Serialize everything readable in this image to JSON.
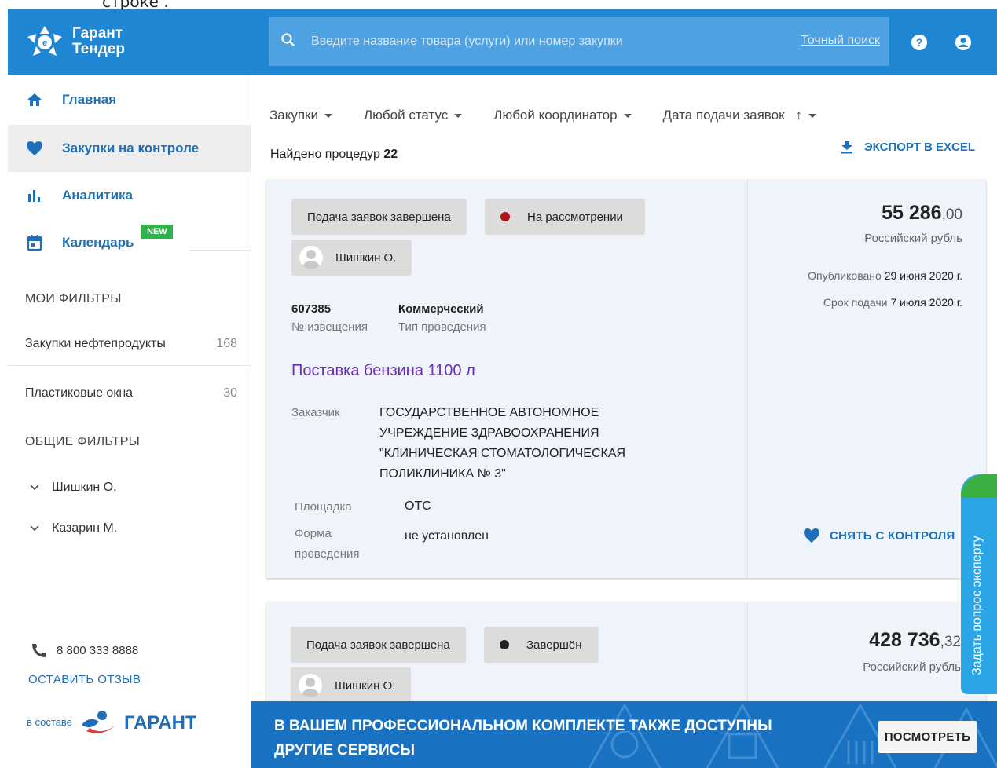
{
  "top_snippet": "строке                    .",
  "header": {
    "logo_line1": "Гарант",
    "logo_line2": "Тендер",
    "search_placeholder": "Введите название товара (услуги) или номер закупки",
    "exact_search": "Точный поиск"
  },
  "sidebar": {
    "items": [
      {
        "label": "Главная",
        "icon": "home-icon"
      },
      {
        "label": "Закупки на контроле",
        "icon": "heart-icon"
      },
      {
        "label": "Аналитика",
        "icon": "analytics-icon"
      },
      {
        "label": "Календарь",
        "icon": "calendar-icon",
        "badge": "NEW"
      }
    ],
    "my_filters_title": "МОИ ФИЛЬТРЫ",
    "my_filters": [
      {
        "label": "Закупки нефтепродукты",
        "count": "168"
      },
      {
        "label": "Пластиковые окна",
        "count": "30"
      }
    ],
    "common_filters_title": "ОБЩИЕ ФИЛЬТРЫ",
    "people": [
      "Шишкин О.",
      "Казарин М."
    ],
    "phone": "8 800 333 8888",
    "feedback": "ОСТАВИТЬ ОТЗЫВ",
    "garant_prefix": "в составе",
    "garant_name": "ГАРАНТ"
  },
  "filters_bar": [
    "Закупки",
    "Любой статус",
    "Любой координатор",
    "Дата подачи заявок"
  ],
  "found_label": "Найдено процедур",
  "found_count": "22",
  "export_label": "ЭКСПОРТ В EXCEL",
  "cards": [
    {
      "status": "Подача заявок завершена",
      "state": "На рассмотрении",
      "state_color": "#b0141c",
      "assignee": "Шишкин О.",
      "notice_number": "607385",
      "notice_label": "№ извещения",
      "type_value": "Коммерческий",
      "type_label": "Тип проведения",
      "title": "Поставка бензина 1100 л",
      "customer_label": "Заказчик",
      "customer": "ГОСУДАРСТВЕННОЕ АВТОНОМНОЕ УЧРЕЖДЕНИЕ ЗДРАВООХРАНЕНИЯ \"КЛИНИЧЕСКАЯ СТОМАТОЛОГИЧЕСКАЯ ПОЛИКЛИНИКА № 3\"",
      "platform_label": "Площадка",
      "platform": "OTC",
      "form_label": "Форма проведения",
      "form": "не установлен",
      "price_int": "55 286",
      "price_dec": ",00",
      "currency": "Российский рубль",
      "published_label": "Опубликовано",
      "published": "29 июня 2020 г.",
      "deadline_label": "Срок подачи",
      "deadline": "7 июля 2020 г.",
      "unwatch": "СНЯТЬ С КОНТРОЛЯ"
    },
    {
      "status": "Подача заявок завершена",
      "state": "Завершён",
      "state_color": "#222222",
      "assignee": "Шишкин О.",
      "price_int": "428 736",
      "price_dec": ",32",
      "currency": "Российский рубль"
    }
  ],
  "ask_expert": "Задать вопрос эксперту",
  "banner": {
    "line1": "В ВАШЕМ ПРОФЕССИОНАЛЬНОМ КОМПЛЕКТЕ ТАКЖЕ ДОСТУПНЫ",
    "line2": "ДРУГИЕ СЕРВИСЫ",
    "button": "ПОСМОТРЕТЬ"
  },
  "colors": {
    "header": "#1f86d4",
    "accent": "#1e6fb8",
    "new_badge": "#2db34a",
    "title_link": "#6a2db3"
  }
}
